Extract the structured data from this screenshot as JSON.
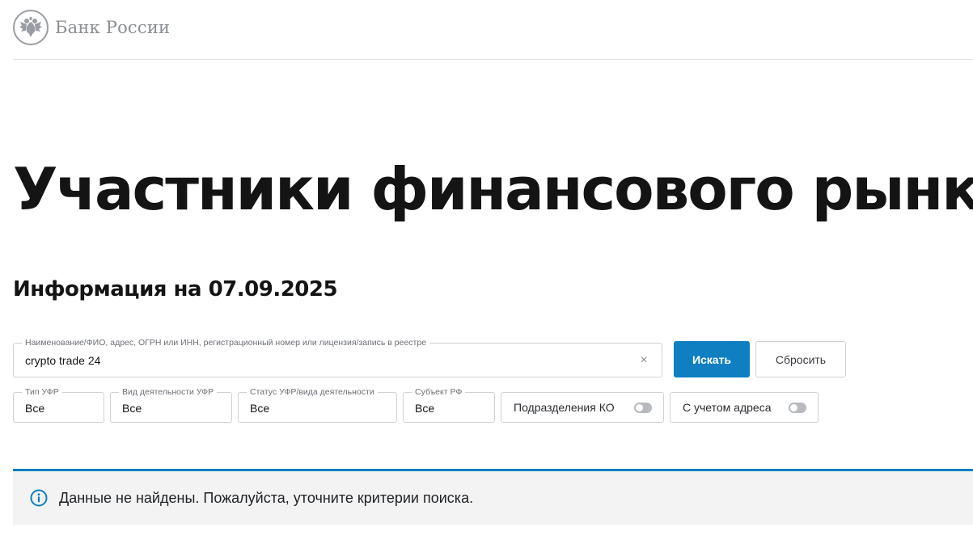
{
  "header": {
    "logo_icon": "double-headed-eagle-icon",
    "logo_text": "Банк России"
  },
  "page": {
    "title": "Участники финансового рынка",
    "info_date": "Информация на 07.09.2025"
  },
  "search": {
    "legend": "Наименование/ФИО, адрес, ОГРН или ИНН, регистрационный номер или лицензия/запись в реестре",
    "value": "crypto trade 24",
    "clear_icon": "close-icon",
    "clear_glyph": "×",
    "search_button": "Искать",
    "reset_button": "Сбросить"
  },
  "filters": [
    {
      "legend": "Тип УФР",
      "value": "Все"
    },
    {
      "legend": "Вид деятельности УФР",
      "value": "Все"
    },
    {
      "legend": "Статус УФР/вида деятельности",
      "value": "Все"
    },
    {
      "legend": "Субъект РФ",
      "value": "Все"
    }
  ],
  "toggles": [
    {
      "label": "Подразделения КО",
      "on": false
    },
    {
      "label": "С учетом адреса",
      "on": false
    }
  ],
  "notice": {
    "icon": "info-icon",
    "text": "Данные не найдены. Пожалуйста, уточните критерии поиска."
  },
  "colors": {
    "accent": "#0f7fc2",
    "notice_bg": "#f3f3f3",
    "border": "#cfd1d4",
    "logo_gray": "#8a8d92"
  }
}
